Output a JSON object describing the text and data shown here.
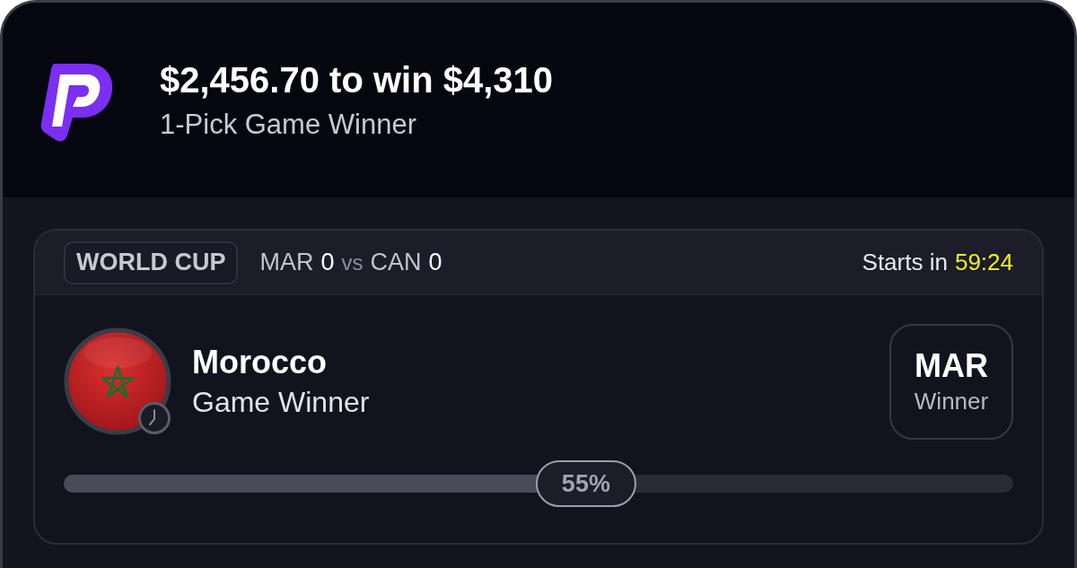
{
  "header": {
    "title": "$2,456.70 to win $4,310",
    "subtitle": "1-Pick Game Winner"
  },
  "pick_card": {
    "league": "WORLD CUP",
    "matchup": {
      "home": {
        "team": "MAR",
        "score": "0"
      },
      "separator": "vs",
      "away": {
        "team": "CAN",
        "score": "0"
      }
    },
    "starts_label": "Starts in",
    "countdown": "59:24",
    "selection": {
      "name": "Morocco",
      "market": "Game Winner"
    },
    "pick": {
      "code": "MAR",
      "label": "Winner"
    },
    "progress": {
      "level": 0.55,
      "reading": "55%"
    }
  }
}
